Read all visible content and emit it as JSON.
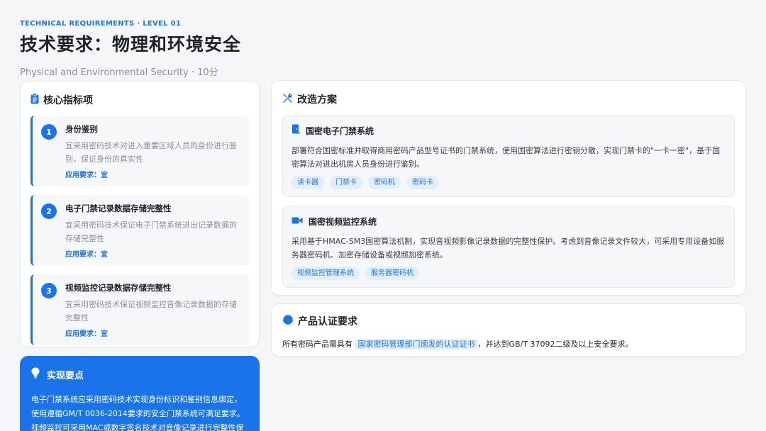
{
  "header": {
    "eyebrow": "TECHNICAL REQUIREMENTS · LEVEL 01",
    "title": "技术要求：物理和环境安全",
    "subtitle": "Physical and Environmental Security · 10分"
  },
  "indicators": {
    "title": "核心指标项",
    "icon": "clipboard-icon",
    "items": [
      {
        "num": "1",
        "name": "身份鉴别",
        "desc": "宜采用密码技术对进入重要区域人员的身份进行鉴别，保证身份的真实性",
        "req": "应用要求：宜"
      },
      {
        "num": "2",
        "name": "电子门禁记录数据存储完整性",
        "desc": "宜采用密码技术保证电子门禁系统进出记录数据的存储完整性",
        "req": "应用要求：宜"
      },
      {
        "num": "3",
        "name": "视频监控记录数据存储完整性",
        "desc": "宜采用密码技术保证视频监控音像记录数据的存储完整性",
        "req": "应用要求：宜"
      }
    ]
  },
  "tips": {
    "title": "实现要点",
    "icon": "lightbulb-icon",
    "body": "电子门禁系统应采用密码技术实现身份标识和鉴别信息绑定，使用遵循GM/T 0036-2014要求的安全门禁系统可满足要求。视频监控可采用MAC或数字签名技术对音像记录进行完整性保护。"
  },
  "plan": {
    "title": "改造方案",
    "icon": "tools-icon",
    "solutions": [
      {
        "title": "国密电子门禁系统",
        "icon": "door-icon",
        "desc": "部署符合国密标准并取得商用密码产品型号证书的门禁系统，使用国密算法进行密钥分散，实现门禁卡的\"一卡一密\"，基于国密算法对进出机房人员身份进行鉴别。",
        "tags": [
          "读卡器",
          "门禁卡",
          "密码机",
          "密码卡"
        ]
      },
      {
        "title": "国密视频监控系统",
        "icon": "video-camera-icon",
        "desc": "采用基于HMAC-SM3国密算法机制，实现音视频影像记录数据的完整性保护。考虑到音像记录文件较大，可采用专用设备如服务器密码机、加密存储设备或视频加密系统。",
        "tags": [
          "视频监控管理系统",
          "服务器密码机"
        ]
      }
    ]
  },
  "cert": {
    "title": "产品认证要求",
    "icon": "certificate-badge-icon",
    "text_before": "所有密码产品需具有",
    "highlight": "国家密码管理部门颁发的认证证书",
    "text_after": "，并达到GB/T 37092二级及以上安全要求。"
  },
  "colors": {
    "accent": "#1a73e8",
    "tag_bg": "#e3eefc",
    "page_bg": "#f5f6f8"
  }
}
